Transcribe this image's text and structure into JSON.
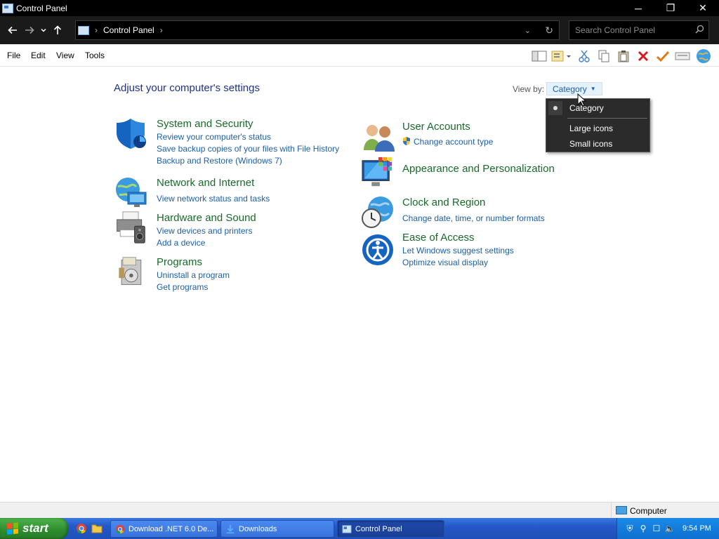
{
  "window": {
    "title": "Control Panel",
    "minimize": "─",
    "restore": "❐",
    "close": "✕"
  },
  "address": {
    "crumb": "Control Panel",
    "search_placeholder": "Search Control Panel"
  },
  "menu": {
    "file": "File",
    "edit": "Edit",
    "view": "View",
    "tools": "Tools"
  },
  "main": {
    "heading": "Adjust your computer's settings",
    "view_by_label": "View by:",
    "view_by_value": "Category"
  },
  "view_menu": {
    "options": [
      "Category",
      "Large icons",
      "Small icons"
    ],
    "selected": "Category"
  },
  "categories": {
    "system_security": {
      "title": "System and Security",
      "links": [
        "Review your computer's status",
        "Save backup copies of your files with File History",
        "Backup and Restore (Windows 7)"
      ]
    },
    "network_internet": {
      "title": "Network and Internet",
      "links": [
        "View network status and tasks"
      ]
    },
    "hardware_sound": {
      "title": "Hardware and Sound",
      "links": [
        "View devices and printers",
        "Add a device"
      ]
    },
    "programs": {
      "title": "Programs",
      "links": [
        "Uninstall a program",
        "Get programs"
      ]
    },
    "user_accounts": {
      "title": "User Accounts",
      "links": [
        "Change account type"
      ]
    },
    "appearance": {
      "title": "Appearance and Personalization",
      "links": []
    },
    "clock_region": {
      "title": "Clock and Region",
      "links": [
        "Change date, time, or number formats"
      ]
    },
    "ease_access": {
      "title": "Ease of Access",
      "links": [
        "Let Windows suggest settings",
        "Optimize visual display"
      ]
    }
  },
  "statusbar": {
    "location": "Computer"
  },
  "taskbar": {
    "start_label": "start",
    "tasks": [
      "Download .NET 6.0 De...",
      "Downloads",
      "Control Panel"
    ],
    "clock": "9:54 PM"
  },
  "colors": {
    "category_title": "#186a2a",
    "link": "#1c5fa8",
    "heading": "#1e3287"
  }
}
